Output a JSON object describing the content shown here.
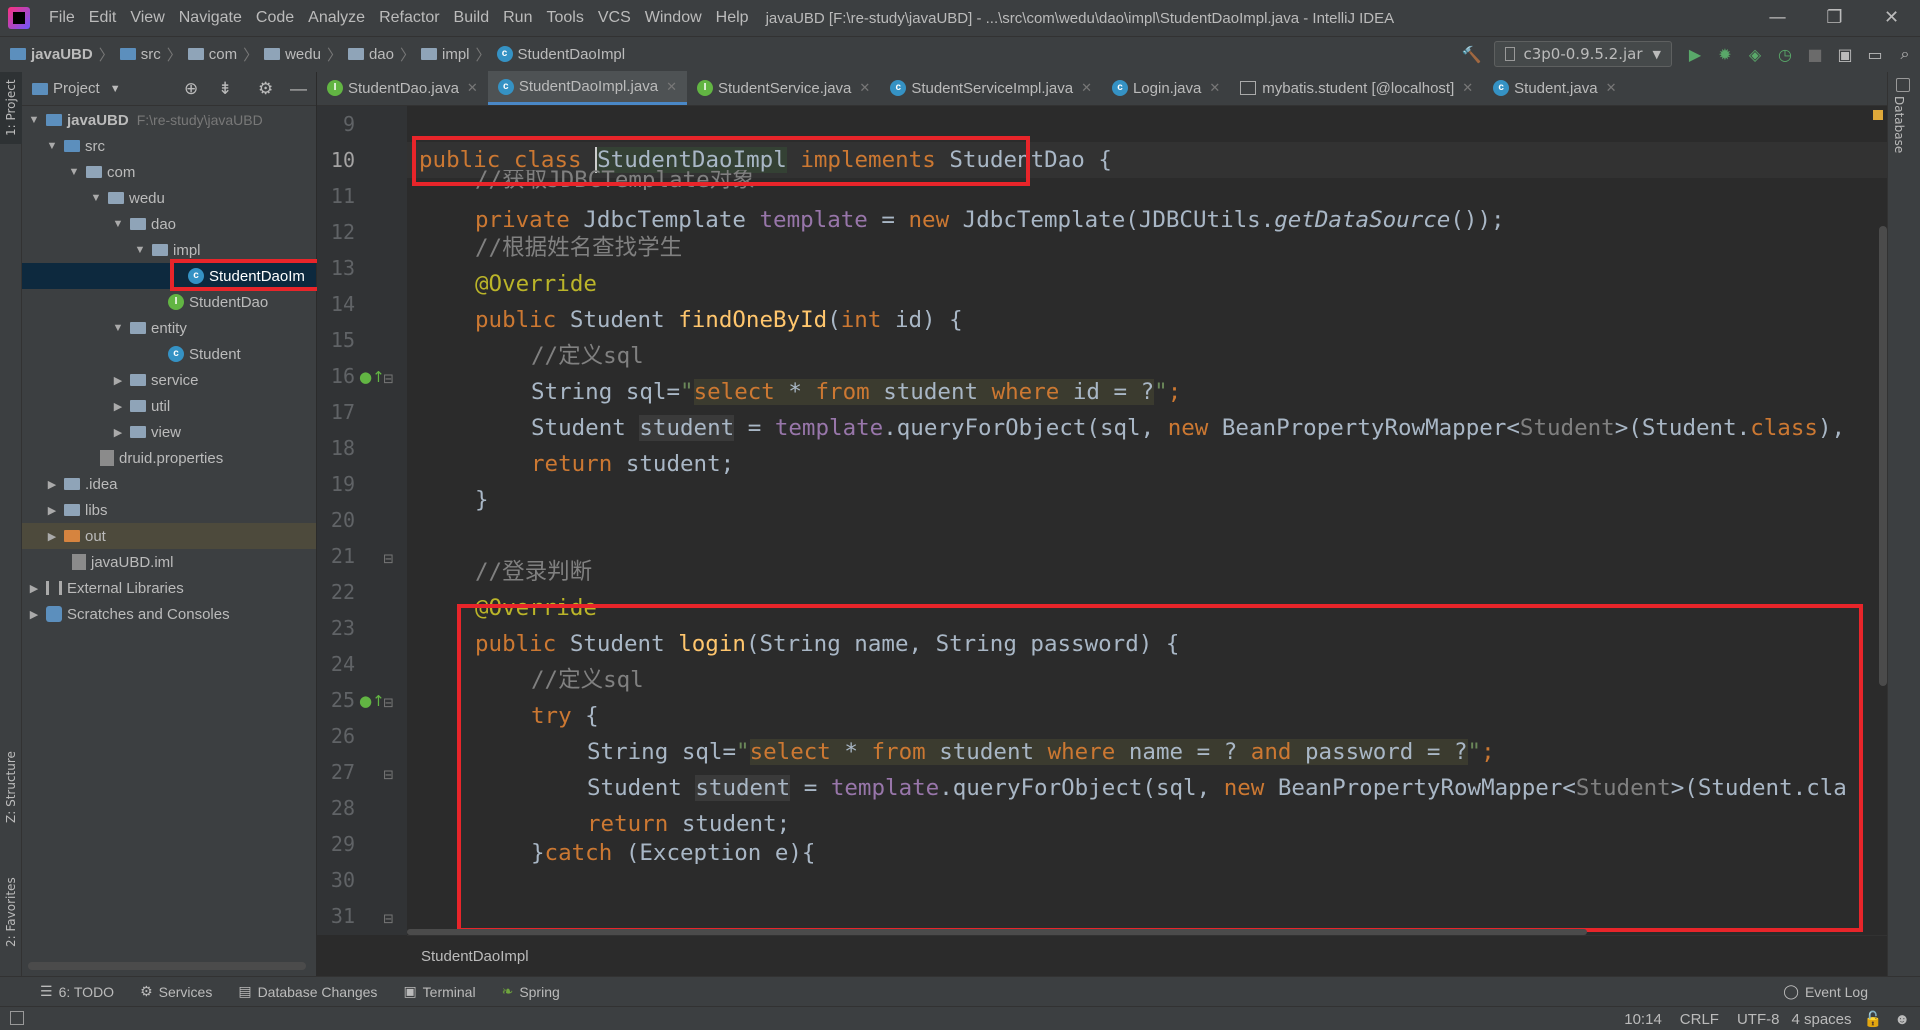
{
  "window": {
    "title": "javaUBD [F:\\re-study\\javaUBD] - ...\\src\\com\\wedu\\dao\\impl\\StudentDaoImpl.java - IntelliJ IDEA",
    "controls": [
      "—",
      "❐",
      "✕"
    ]
  },
  "menu": [
    "File",
    "Edit",
    "View",
    "Navigate",
    "Code",
    "Analyze",
    "Refactor",
    "Build",
    "Run",
    "Tools",
    "VCS",
    "Window",
    "Help"
  ],
  "breadcrumb": [
    "javaUBD",
    "src",
    "com",
    "wedu",
    "dao",
    "impl",
    "StudentDaoImpl"
  ],
  "run_config": "c3p0-0.9.5.2.jar",
  "project_panel": {
    "title": "Project",
    "tree": [
      {
        "label": "javaUBD",
        "extra": "F:\\re-study\\javaUBD",
        "icon": "folder",
        "arrow": "▼"
      },
      {
        "label": "src",
        "icon": "folder-blue",
        "arrow": "▼"
      },
      {
        "label": "com",
        "icon": "folder",
        "arrow": "▼"
      },
      {
        "label": "wedu",
        "icon": "folder",
        "arrow": "▼"
      },
      {
        "label": "dao",
        "icon": "folder",
        "arrow": "▼"
      },
      {
        "label": "impl",
        "icon": "folder",
        "arrow": "▼"
      },
      {
        "label": "StudentDaoIm",
        "icon": "class",
        "arrow": ""
      },
      {
        "label": "StudentDao",
        "icon": "interface",
        "arrow": ""
      },
      {
        "label": "entity",
        "icon": "folder",
        "arrow": "▼"
      },
      {
        "label": "Student",
        "icon": "class",
        "arrow": ""
      },
      {
        "label": "service",
        "icon": "folder",
        "arrow": "▶"
      },
      {
        "label": "util",
        "icon": "folder",
        "arrow": "▶"
      },
      {
        "label": "view",
        "icon": "folder",
        "arrow": "▶"
      },
      {
        "label": "druid.properties",
        "icon": "file",
        "arrow": ""
      },
      {
        "label": ".idea",
        "icon": "folder",
        "arrow": "▶"
      },
      {
        "label": "libs",
        "icon": "folder",
        "arrow": "▶"
      },
      {
        "label": "out",
        "icon": "folder-orange",
        "arrow": "▶"
      },
      {
        "label": "javaUBD.iml",
        "icon": "file",
        "arrow": ""
      },
      {
        "label": "External Libraries",
        "icon": "libs",
        "arrow": "▶"
      },
      {
        "label": "Scratches and Consoles",
        "icon": "scratch",
        "arrow": "▶"
      }
    ]
  },
  "tabs": [
    {
      "label": "StudentDao.java",
      "icon": "interface"
    },
    {
      "label": "StudentDaoImpl.java",
      "icon": "class",
      "active": true
    },
    {
      "label": "StudentService.java",
      "icon": "interface"
    },
    {
      "label": "StudentServiceImpl.java",
      "icon": "class"
    },
    {
      "label": "Login.java",
      "icon": "class"
    },
    {
      "label": "mybatis.student [@localhost]",
      "icon": "table"
    },
    {
      "label": "Student.java",
      "icon": "class"
    }
  ],
  "line_numbers": [
    "9",
    "10",
    "11",
    "12",
    "13",
    "14",
    "15",
    "16",
    "17",
    "18",
    "19",
    "20",
    "21",
    "22",
    "23",
    "24",
    "25",
    "26",
    "27",
    "28",
    "29",
    "30",
    "31"
  ],
  "code": {
    "l10": [
      "public",
      " ",
      "class",
      " ",
      "StudentDaoImpl",
      " ",
      "implements",
      " StudentDao {"
    ],
    "l11": "//获取JDBCTemplate对象",
    "l12": [
      "private",
      " JdbcTemplate ",
      "template",
      " = ",
      "new",
      " JdbcTemplate(JDBCUtils.",
      "getDataSource",
      "());"
    ],
    "l14": "//根据姓名查找学生",
    "l15": "@Override",
    "l16": [
      "public",
      " Student ",
      "findOneById",
      "(",
      "int",
      " id) {"
    ],
    "l17": "//定义sql",
    "l18": [
      "String sql=",
      "\"",
      "select",
      " * ",
      "from",
      " student ",
      "where",
      " id = ?",
      "\"",
      ";"
    ],
    "l19": [
      "Student ",
      "student",
      " = ",
      "template",
      ".queryForObject(sql, ",
      "new",
      " BeanPropertyRowMapper<",
      "Student",
      ">(Student.",
      "class",
      "),"
    ],
    "l20": [
      "return",
      " student;"
    ],
    "l21": "}",
    "l23": "//登录判断",
    "l24": "@Override",
    "l25": [
      "public",
      " Student ",
      "login",
      "(String name, String password) {"
    ],
    "l26": "//定义sql",
    "l27": [
      "try",
      " {"
    ],
    "l28": [
      "String sql=",
      "\"",
      "select",
      " * ",
      "from",
      " student ",
      "where",
      " name = ? ",
      "and",
      " password = ?",
      "\"",
      ";"
    ],
    "l29": [
      "Student ",
      "student",
      " = ",
      "template",
      ".queryForObject(sql, ",
      "new",
      " BeanPropertyRowMapper<",
      "Student",
      ">(Student.cla"
    ],
    "l30": [
      "return",
      " student;"
    ],
    "l31": [
      "}",
      "catch",
      " (Exception e){"
    ]
  },
  "editor_breadcrumb": "StudentDaoImpl",
  "left_tool_tabs": [
    "1: Project",
    "Z: Structure",
    "2: Favorites"
  ],
  "right_tool_tabs": [
    "Database"
  ],
  "bottom_tools": [
    "6: TODO",
    "Services",
    "Database Changes",
    "Terminal",
    "Spring"
  ],
  "event_log": "Event Log",
  "status": {
    "position": "10:14",
    "line_sep": "CRLF",
    "encoding": "UTF-8",
    "indent": "4 spaces"
  }
}
